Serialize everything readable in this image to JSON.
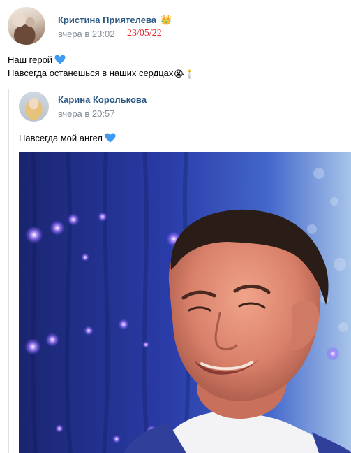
{
  "post": {
    "author": "Кристина Приятелева",
    "time": "вчера в 23:02",
    "date_stamp": "23/05/22",
    "lines": [
      "Наш герой",
      "Навсегда останешься в наших сердцах"
    ]
  },
  "repost": {
    "author": "Карина Королькова",
    "time": "вчера в 20:57",
    "text": "Навсегда мой ангел"
  },
  "emoji": {
    "crown": "👑",
    "crying": "😭",
    "candle": "🕯️"
  },
  "colors": {
    "author_link": "#2a5885",
    "secondary_text": "#818c99",
    "date_stamp": "#e0262a",
    "heart": "#3e9bf2",
    "repost_border": "#dce1e6"
  },
  "icons": {
    "crown": "crown-icon",
    "heart": "blue-heart-icon",
    "crying": "crying-face-icon",
    "candle": "candle-icon"
  }
}
